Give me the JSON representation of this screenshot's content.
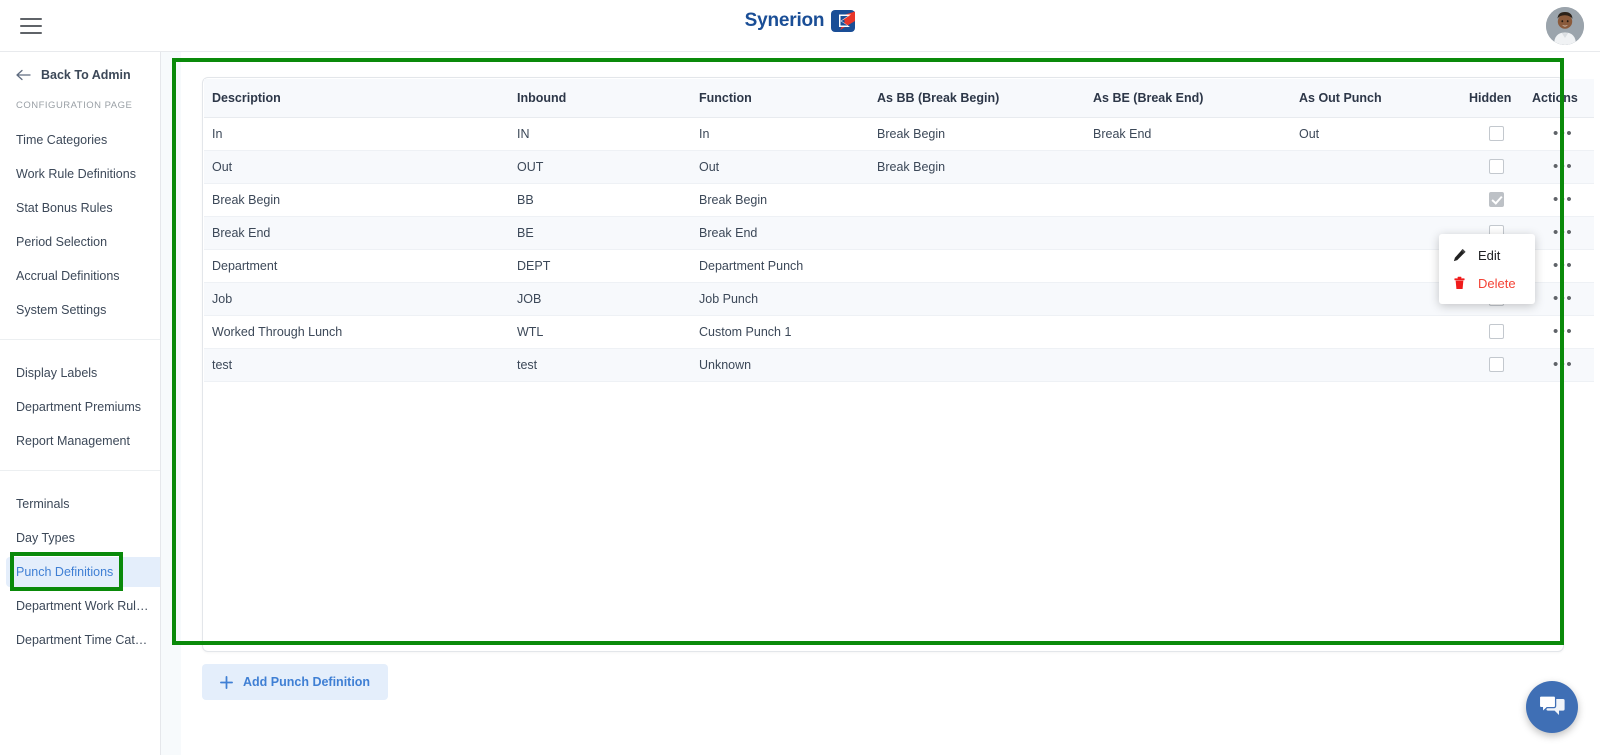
{
  "topbar": {
    "menu_icon": "hamburger-menu-icon",
    "brand_name": "Synerion",
    "brand_mark": "synerion-logo-mark",
    "avatar_alt": "user-avatar"
  },
  "sidebar": {
    "back_label": "Back To Admin",
    "section_label": "CONFIGURATION PAGE",
    "groups": [
      {
        "items": [
          {
            "label": "Time Categories",
            "active": false
          },
          {
            "label": "Work Rule Definitions",
            "active": false
          },
          {
            "label": "Stat Bonus Rules",
            "active": false
          },
          {
            "label": "Period Selection",
            "active": false
          },
          {
            "label": "Accrual Definitions",
            "active": false
          },
          {
            "label": "System Settings",
            "active": false
          }
        ]
      },
      {
        "items": [
          {
            "label": "Display Labels",
            "active": false
          },
          {
            "label": "Department Premiums",
            "active": false
          },
          {
            "label": "Report Management",
            "active": false
          }
        ]
      },
      {
        "items": [
          {
            "label": "Terminals",
            "active": false
          },
          {
            "label": "Day Types",
            "active": false
          },
          {
            "label": "Punch Definitions",
            "active": true
          },
          {
            "label": "Department Work Rules Filt...",
            "active": false
          },
          {
            "label": "Department Time Category ...",
            "active": false
          }
        ]
      }
    ]
  },
  "table": {
    "columns": [
      "Description",
      "Inbound",
      "Function",
      "As BB (Break Begin)",
      "As BE (Break End)",
      "As Out Punch",
      "Hidden",
      "Actions"
    ],
    "rows": [
      {
        "description": "In",
        "inbound": "IN",
        "function": "In",
        "as_bb": "Break Begin",
        "as_be": "Break End",
        "as_out": "Out",
        "hidden": false
      },
      {
        "description": "Out",
        "inbound": "OUT",
        "function": "Out",
        "as_bb": "Break Begin",
        "as_be": "",
        "as_out": "",
        "hidden": false
      },
      {
        "description": "Break Begin",
        "inbound": "BB",
        "function": "Break Begin",
        "as_bb": "",
        "as_be": "",
        "as_out": "",
        "hidden": true
      },
      {
        "description": "Break End",
        "inbound": "BE",
        "function": "Break End",
        "as_bb": "",
        "as_be": "",
        "as_out": "",
        "hidden": false
      },
      {
        "description": "Department",
        "inbound": "DEPT",
        "function": "Department Punch",
        "as_bb": "",
        "as_be": "",
        "as_out": "",
        "hidden": false
      },
      {
        "description": "Job",
        "inbound": "JOB",
        "function": "Job Punch",
        "as_bb": "",
        "as_be": "",
        "as_out": "",
        "hidden": false
      },
      {
        "description": "Worked Through Lunch",
        "inbound": "WTL",
        "function": "Custom Punch 1",
        "as_bb": "",
        "as_be": "",
        "as_out": "",
        "hidden": false
      },
      {
        "description": "test",
        "inbound": "test",
        "function": "Unknown",
        "as_bb": "",
        "as_be": "",
        "as_out": "",
        "hidden": false
      }
    ],
    "action_cell_icon": "more-horizontal-icon"
  },
  "context_menu": {
    "edit_label": "Edit",
    "edit_icon": "pencil-icon",
    "delete_label": "Delete",
    "delete_icon": "trash-icon",
    "delete_color": "#f44336"
  },
  "actions": {
    "add_label": "Add Punch Definition",
    "add_icon": "plus-icon"
  },
  "fab": {
    "icon": "chat-bubbles-icon",
    "color": "#3f6fb5"
  },
  "annotations": {
    "accent_color": "#0a8a0a"
  }
}
